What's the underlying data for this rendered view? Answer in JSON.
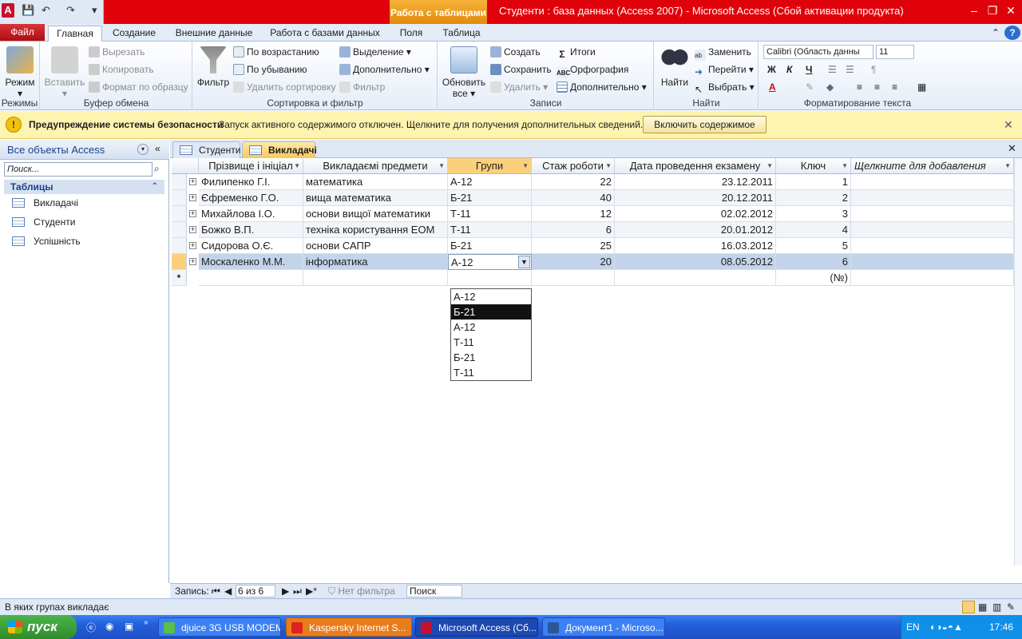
{
  "title_bar": {
    "context_tab": "Работа с таблицами",
    "app_title": "Студенти : база данных (Access 2007)  -  Microsoft Access (Сбой активации продукта)",
    "min": "–",
    "max": "❐",
    "close": "✕"
  },
  "ribbon_tabs": [
    "Файл",
    "Главная",
    "Создание",
    "Внешние данные",
    "Работа с базами данных",
    "Поля",
    "Таблица"
  ],
  "ribbon": {
    "groups": {
      "views": "Режимы",
      "clipboard": "Буфер обмена",
      "sort": "Сортировка и фильтр",
      "records": "Записи",
      "find": "Найти",
      "text": "Форматирование текста"
    },
    "view_btn": "Режим",
    "paste_btn": "Вставить",
    "cut": "Вырезать",
    "copy": "Копировать",
    "format_painter": "Формат по образцу",
    "filter_btn": "Фильтр",
    "sort_asc": "По возрастанию",
    "sort_desc": "По убыванию",
    "remove_sort": "Удалить сортировку",
    "selection": "Выделение",
    "advanced": "Дополнительно",
    "toggle_filter": "Фильтр",
    "refresh_btn": "Обновить",
    "refresh_btn2": "все",
    "new": "Создать",
    "save": "Сохранить",
    "delete": "Удалить",
    "totals": "Итоги",
    "spelling": "Орфография",
    "more": "Дополнительно",
    "find_btn": "Найти",
    "replace": "Заменить",
    "goto": "Перейти",
    "select": "Выбрать",
    "font_name": "Calibri (Область данны",
    "font_size": "11"
  },
  "message_bar": {
    "title": "Предупреждение системы безопасности",
    "text": "Запуск активного содержимого отключен. Щелкните для получения дополнительных сведений.",
    "button": "Включить содержимое"
  },
  "nav_pane": {
    "header": "Все объекты Access",
    "search_placeholder": "Поиск...",
    "section": "Таблицы",
    "items": [
      "Викладачі",
      "Студенти",
      "Успішність"
    ]
  },
  "doc_tabs": [
    "Студенти",
    "Викладачі"
  ],
  "table": {
    "columns": [
      "Прізвище і ініціал",
      "Викладаємі предмети",
      "Групи",
      "Стаж роботи",
      "Дата проведення екзамену",
      "Ключ",
      "Щелкните для добавления"
    ],
    "rows": [
      [
        "Филипенко Г.І.",
        "математика",
        "А-12",
        "22",
        "23.12.2011",
        "1"
      ],
      [
        "Єфременко Г.О.",
        "вища математика",
        "Б-21",
        "40",
        "20.12.2011",
        "2"
      ],
      [
        "Михайлова І.О.",
        "основи вищої математики",
        "Т-11",
        "12",
        "02.02.2012",
        "3"
      ],
      [
        "Божко В.П.",
        "техніка користування ЕОМ",
        "Т-11",
        "6",
        "20.01.2012",
        "4"
      ],
      [
        "Сидорова О.Є.",
        "основи САПР",
        "Б-21",
        "25",
        "16.03.2012",
        "5"
      ],
      [
        "Москаленко М.М.",
        "інформатика",
        "А-12",
        "20",
        "08.05.2012",
        "6"
      ]
    ],
    "new_row_marker": "*",
    "new_row_key": "(№)"
  },
  "dropdown": {
    "options": [
      "А-12",
      "Б-21",
      "А-12",
      "Т-11",
      "Б-21",
      "Т-11"
    ],
    "highlighted_index": 1
  },
  "record_nav": {
    "label": "Запись:",
    "position": "6 из 6",
    "filter": "Нет фильтра",
    "search": "Поиск"
  },
  "status_bar": {
    "text": "В яких групах  викладає"
  },
  "taskbar": {
    "start": "пуск",
    "tasks": [
      "djuice 3G USB MODEM",
      "Kaspersky Internet S...",
      "Microsoft Access (Сб...",
      "Документ1 - Microso..."
    ],
    "lang": "EN",
    "clock": "17:46"
  },
  "colors": {
    "title_red": "#e0020a",
    "context_orange": "#f0a020",
    "selection_blue": "#c3d4ea",
    "taskbar_blue": "#245edb"
  }
}
